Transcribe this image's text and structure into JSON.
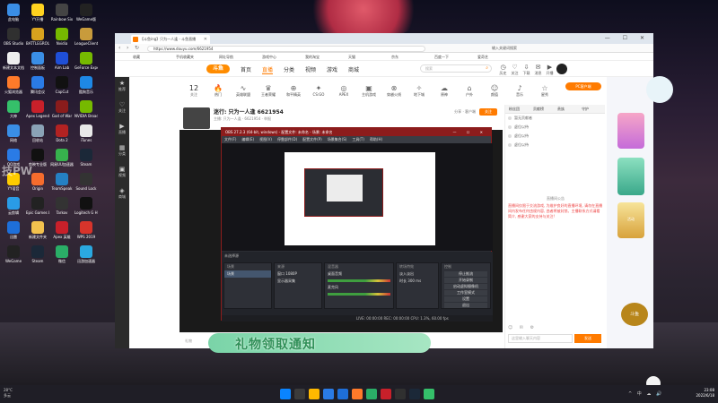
{
  "desktop": {
    "icons": [
      {
        "label": "此电脑",
        "color": "#3a8ee6"
      },
      {
        "label": "OBS Studio",
        "color": "#303030"
      },
      {
        "label": "新建文本文档",
        "color": "#eeeeee"
      },
      {
        "label": "火狐浏览器",
        "color": "#ff7a2a"
      },
      {
        "label": "大神",
        "color": "#35c06a"
      },
      {
        "label": "网络",
        "color": "#3a8ee6"
      },
      {
        "label": "QQ游戏",
        "color": "#2a7be6"
      },
      {
        "label": "YY语音",
        "color": "#ffcc00"
      },
      {
        "label": "云剪辑",
        "color": "#2a9be6"
      },
      {
        "label": "迅雷",
        "color": "#1e6fd9"
      },
      {
        "label": "WeGame",
        "color": "#222222"
      },
      {
        "label": "YY开播",
        "color": "#ffd21f"
      },
      {
        "label": "BATTLEGROUNDS",
        "color": "#d9a21e"
      },
      {
        "label": "控制面板",
        "color": "#3a8ee6"
      },
      {
        "label": "腾讯会议",
        "color": "#2a7be6"
      },
      {
        "label": "Apex Legends",
        "color": "#c8202a"
      },
      {
        "label": "回收站",
        "color": "#8aa2b6"
      },
      {
        "label": "剪映专业版",
        "color": "#111111"
      },
      {
        "label": "Origin",
        "color": "#f56c2d"
      },
      {
        "label": "Epic Games Launcher",
        "color": "#222222"
      },
      {
        "label": "新建文件夹",
        "color": "#f2c14e"
      },
      {
        "label": "Steam",
        "color": "#1b2838"
      },
      {
        "label": "Rainbow Six",
        "color": "#444444"
      },
      {
        "label": "Nvidia",
        "color": "#76b900"
      },
      {
        "label": "Aim Lab",
        "color": "#1f4fd6"
      },
      {
        "label": "CapCut",
        "color": "#111111"
      },
      {
        "label": "God of War",
        "color": "#8a1c1c"
      },
      {
        "label": "Dota 2",
        "color": "#b22222"
      },
      {
        "label": "网易UU加速器",
        "color": "#37b24d"
      },
      {
        "label": "TeamSpeak",
        "color": "#2580c3"
      },
      {
        "label": "Tarkov",
        "color": "#333333"
      },
      {
        "label": "Apex 英雄",
        "color": "#c8202a"
      },
      {
        "label": "微信",
        "color": "#2aae67"
      },
      {
        "label": "WeGame版",
        "color": "#222222"
      },
      {
        "label": "LeagueClient",
        "color": "#c89b3c"
      },
      {
        "label": "GeForce Experience",
        "color": "#76b900"
      },
      {
        "label": "酷狗音乐",
        "color": "#1e88e5"
      },
      {
        "label": "NVIDIA Broadcast",
        "color": "#76b900"
      },
      {
        "label": "iTunes",
        "color": "#e8e8e8"
      },
      {
        "label": "Steam ",
        "color": "#1b2838"
      },
      {
        "label": "Sound Lock",
        "color": "#333333"
      },
      {
        "label": "Logitech G HUB",
        "color": "#111111"
      },
      {
        "label": "WPS 2019",
        "color": "#d7342b"
      },
      {
        "label": "迅游加速器",
        "color": "#2aa8e0"
      }
    ],
    "watermark": "技PW"
  },
  "browser": {
    "tab_title": "【斗鱼ing】只为一人逢 - 斗鱼直播",
    "window_controls": "— ☐ ✕",
    "url": "https://www.douyu.com/6621954",
    "address_right": "输入关键词搜索",
    "bookmarks": [
      "收藏",
      "手机收藏夹",
      "网址导航",
      "游戏中心",
      "我的淘宝",
      "天猫",
      "京东",
      "百度一下",
      "爱奇艺"
    ],
    "header": {
      "logo": "斗鱼",
      "nav": [
        "首页",
        "直播",
        "分类",
        "视频",
        "游戏",
        "商城"
      ],
      "active_nav": "直播",
      "search_placeholder": "搜索",
      "right_items": [
        "历史",
        "关注",
        "下载",
        "消息",
        "开播"
      ]
    },
    "site_sidebar": [
      "推荐",
      "关注",
      "直播",
      "分类",
      "视频",
      "商城"
    ],
    "category": {
      "count_value": "12",
      "count_label": "关注",
      "items": [
        "热门",
        "英雄联盟",
        "王者荣耀",
        "和平精英",
        "CS:GO",
        "APEX",
        "主机游戏",
        "穿越火线",
        "地下城",
        "原神",
        "户外",
        "颜值",
        "音乐",
        "星秀"
      ],
      "pc_button": "PC客户端"
    },
    "room": {
      "title": "迷行: 只为一人逢 6621954",
      "subtitle": "主播: 只为一人逢 · 6621954 · 举报",
      "follow": "关注",
      "right": "分享 · 客户端"
    },
    "video_bottom_label": "礼物",
    "chat": {
      "tabs": [
        "粉丝团",
        "贡献榜",
        "贵族",
        "守护"
      ],
      "ranks": [
        "暂无贡献者",
        "虚位以待",
        "虚位以待",
        "虚位以待"
      ],
      "notice_title": "直播间公告",
      "notice": "直播间仅限于交流游戏, 为维护良好的直播环境, 请勿在直播间内发布任何违规内容, 违者将被封禁。主播联系方式请看简介, 感谢大家的支持与关注!",
      "input_placeholder": "这里输入聊天内容",
      "send": "发送",
      "links": "设置 · 全屏 · 弹幕"
    },
    "ads_label": "活动"
  },
  "obs": {
    "title": "OBS 27.2.3 (64-bit, windows) - 配置文件: 未命名 - 场景: 未命名",
    "menu": [
      "文件(F)",
      "编辑(E)",
      "视图(V)",
      "停靠部件(D)",
      "配置文件(P)",
      "场景集合(S)",
      "工具(T)",
      "帮助(H)"
    ],
    "preview_label": "未选择源",
    "docks": {
      "scenes": {
        "title": "场景",
        "items": [
          "场景"
        ]
      },
      "sources": {
        "title": "来源",
        "items": [
          "窗口 1080P",
          "显示器采集"
        ]
      },
      "mixer": {
        "title": "混音器",
        "items": [
          "桌面音频",
          "麦克风"
        ]
      },
      "transitions": {
        "title": "转场特效",
        "items": [
          "淡入淡出",
          "时长 300 ms"
        ]
      },
      "controls": {
        "title": "控制",
        "items": [
          "停止推流",
          "开始录制",
          "启动虚拟摄像机",
          "工作室模式",
          "设置",
          "退出"
        ]
      }
    },
    "status": "LIVE: 00:00:00   REC: 00:00:00   CPU: 1.3%, 60.00 fps"
  },
  "overlay": {
    "banner": "礼物领取通知",
    "stamp": "斗鱼"
  },
  "taskbar": {
    "weather_temp": "28°C",
    "weather_desc": "多云",
    "app_colors": [
      "#0a84ff",
      "#3b3b3b",
      "#ffb900",
      "#2a7be6",
      "#1e6fd9",
      "#ff7a2a",
      "#2aae67",
      "#c8202a",
      "#303030",
      "#1b2838",
      "#35c06a"
    ],
    "tray": "^ 中 ☁ 🔊",
    "time": "23:08",
    "date": "2022/6/18"
  }
}
